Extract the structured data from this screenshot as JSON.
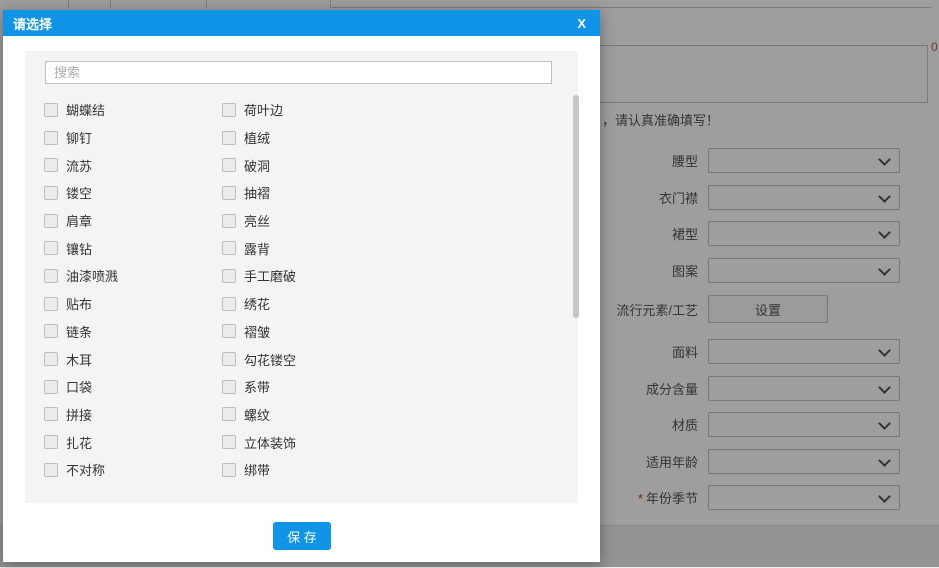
{
  "colors": {
    "accent": "#1094e8",
    "required": "#d03a3a",
    "panel": "#f4f4f4"
  },
  "modal": {
    "title": "请选择",
    "close_label": "X",
    "search_placeholder": "搜索",
    "save_label": "保 存",
    "options_left": [
      "蝴蝶结",
      "铆钉",
      "流苏",
      "镂空",
      "肩章",
      "镶钻",
      "油漆喷溅",
      "贴布",
      "链条",
      "木耳",
      "口袋",
      "拼接",
      "扎花",
      "不对称"
    ],
    "options_right": [
      "荷叶边",
      "植绒",
      "破洞",
      "抽褶",
      "亮丝",
      "露背",
      "手工磨破",
      "绣花",
      "褶皱",
      "勾花镂空",
      "系带",
      "螺纹",
      "立体装饰",
      "绑带"
    ]
  },
  "background_form": {
    "notice_text": "，请认真准确填写！",
    "char_count": "0",
    "required_mark": "*",
    "rows": [
      {
        "label": "腰型",
        "type": "select"
      },
      {
        "label": "衣门襟",
        "type": "select"
      },
      {
        "label": "裙型",
        "type": "select"
      },
      {
        "label": "图案",
        "type": "select"
      },
      {
        "label": "流行元素/工艺",
        "type": "button",
        "button_label": "设置"
      },
      {
        "label": "面料",
        "type": "select"
      },
      {
        "label": "成分含量",
        "type": "select"
      },
      {
        "label": "材质",
        "type": "select"
      },
      {
        "label": "适用年龄",
        "type": "select"
      },
      {
        "label": "年份季节",
        "type": "select",
        "required": true
      }
    ]
  }
}
